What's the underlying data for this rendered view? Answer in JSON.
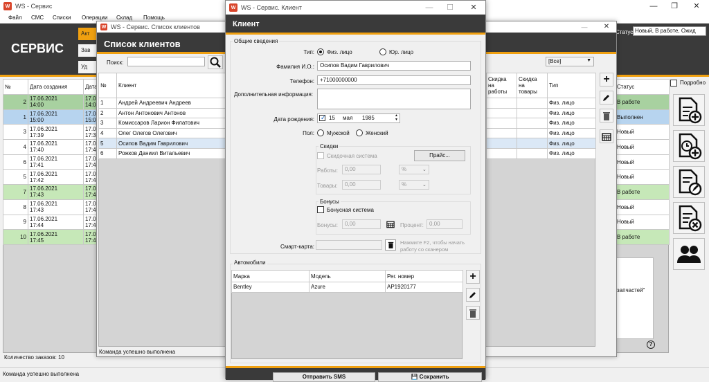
{
  "main": {
    "title": "WS - Сервис",
    "menu": [
      "Файл",
      "СМС",
      "Списки",
      "Операции",
      "Склад",
      "Помощь"
    ],
    "brand": "СЕРВИС",
    "tabs": [
      "Акт",
      "Зав",
      "Уд"
    ],
    "status_label": "Статус:",
    "status_value": "Новый, В работе, Ожид",
    "detailed_label": "Подробно",
    "col_num": "№",
    "col_date": "Дата создания",
    "col_date2": "Дата",
    "col_status": "Статус",
    "orders": [
      {
        "num": "2",
        "date": "17.06.2021",
        "time": "14:00",
        "d2": "17.0",
        "t2": "14:0",
        "status": "В работе",
        "color": "#a8d1a0"
      },
      {
        "num": "1",
        "date": "17.06.2021",
        "time": "15:00",
        "d2": "17.0",
        "t2": "15:0",
        "status": "Выполнен",
        "color": "#b7d4ef"
      },
      {
        "num": "3",
        "date": "17.06.2021",
        "time": "17:39",
        "d2": "17.0",
        "t2": "17:3",
        "status": "Новый",
        "color": "#ffffff"
      },
      {
        "num": "4",
        "date": "17.06.2021",
        "time": "17:40",
        "d2": "17.0",
        "t2": "17:4",
        "status": "Новый",
        "color": "#ffffff"
      },
      {
        "num": "6",
        "date": "17.06.2021",
        "time": "17:41",
        "d2": "17.0",
        "t2": "17:4",
        "status": "Новый",
        "color": "#ffffff"
      },
      {
        "num": "5",
        "date": "17.06.2021",
        "time": "17:42",
        "d2": "17.0",
        "t2": "17:4",
        "status": "Новый",
        "color": "#ffffff"
      },
      {
        "num": "7",
        "date": "17.06.2021",
        "time": "17:43",
        "d2": "17.0",
        "t2": "17:4",
        "status": "В работе",
        "color": "#c6e8b8"
      },
      {
        "num": "8",
        "date": "17.06.2021",
        "time": "17:43",
        "d2": "17.0",
        "t2": "17:4",
        "status": "Новый",
        "color": "#ffffff"
      },
      {
        "num": "9",
        "date": "17.06.2021",
        "time": "17:44",
        "d2": "17.0",
        "t2": "17:4",
        "status": "Новый",
        "color": "#ffffff"
      },
      {
        "num": "10",
        "date": "17.06.2021",
        "time": "17:45",
        "d2": "17.0",
        "t2": "17:4",
        "status": "В работе",
        "color": "#c6e8b8"
      }
    ],
    "info_text": "запчастей\"",
    "order_count": "Количество заказов: 10",
    "status_bar": "Команда успешно выполнена"
  },
  "clients_window": {
    "title": "WS - Сервис. Список клиентов",
    "header": "Список клиентов",
    "search_label": "Поиск:",
    "search_value": "",
    "filter_value": "[Все]",
    "col_num": "№",
    "col_client": "Клиент",
    "col_disc_work": [
      "Скидка",
      "на",
      "работы"
    ],
    "col_disc_goods": [
      "Скидка",
      "на",
      "товары"
    ],
    "col_type": "Тип",
    "clients": [
      {
        "num": "1",
        "name": "Андрей Андреевич Андреев",
        "type": "Физ. лицо"
      },
      {
        "num": "2",
        "name": "Антон Антонович Антонов",
        "type": "Физ. лицо"
      },
      {
        "num": "3",
        "name": "Комиссаров Ларион Филатович",
        "type": "Физ. лицо"
      },
      {
        "num": "4",
        "name": "Олег Олегов Олегович",
        "type": "Физ. лицо"
      },
      {
        "num": "5",
        "name": "Осипов Вадим Гаврилович",
        "type": "Физ. лицо"
      },
      {
        "num": "6",
        "name": "Рожков Даниил Витальевич",
        "type": "Физ. лицо"
      }
    ],
    "status_bar": "Команда успешно выполнена"
  },
  "client_dialog": {
    "title": "WS - Сервис. Клиент",
    "header": "Клиент",
    "section_general": "Общие сведения",
    "type_label": "Тип:",
    "type_individual": "Физ. лицо",
    "type_legal": "Юр. лицо",
    "name_label": "Фамилия И.О.:",
    "name_value": "Осипов Вадим Гаврилович",
    "phone_label": "Телефон:",
    "phone_value": "+71000000000",
    "extra_label": "Дополнительная информация:",
    "extra_value": "",
    "birth_label": "Дата рождения:",
    "birth_day": "15",
    "birth_month": "мая",
    "birth_year": "1985",
    "gender_label": "Пол:",
    "gender_male": "Мужской",
    "gender_female": "Женский",
    "section_discounts": "Скидки",
    "discount_system": "Скидочная система",
    "price_button": "Прайс...",
    "works_label": "Работы:",
    "works_value": "0,00",
    "goods_label": "Товары:",
    "goods_value": "0,00",
    "percent": "%",
    "section_bonuses": "Бонусы",
    "bonus_system": "Бонусная система",
    "bonuses_label": "Бонусы:",
    "bonuses_value": "0,00",
    "percent_label": "Процент:",
    "percent_value": "0,00",
    "smartcard_label": "Смарт-карта:",
    "smartcard_value": "",
    "smartcard_hint_1": "Нажмите F2, чтобы начать",
    "smartcard_hint_2": "работу со сканером",
    "section_cars": "Автомобили",
    "col_brand": "Марка",
    "col_model": "Модель",
    "col_reg": "Рег. номер",
    "cars": [
      {
        "brand": "Bentley",
        "model": "Azure",
        "reg": "AP1920177"
      }
    ],
    "send_sms_button": "Отправить SMS",
    "save_button": "Сохранить"
  },
  "icons": {
    "accent": "#f0a010",
    "dark": "#3a3a3a",
    "app_icon_color": "#d9452b"
  }
}
